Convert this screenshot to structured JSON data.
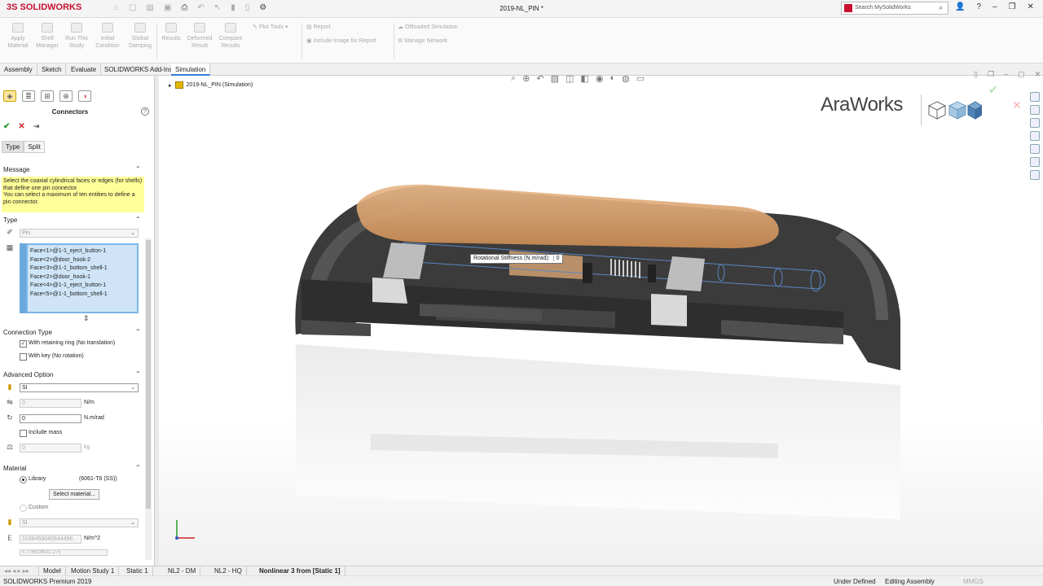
{
  "app": {
    "logo_ds": "3S",
    "logo_name": "SOLIDWORKS",
    "doc_title": "2019-NL_PIN *",
    "search_placeholder": "Search MySolidWorks",
    "version": "SOLIDWORKS Premium 2019"
  },
  "ribbon": {
    "buttons": [
      "Apply Material",
      "Shell Manager",
      "Run This Study",
      "Initial Condition",
      "Global Damping",
      "Results",
      "Deformed Result",
      "Compare Results"
    ],
    "plot_tools": "Plot Tools",
    "report": "Report",
    "include_image": "Include Image for Report",
    "offloaded": "Offloaded Simulation",
    "manage_network": "Manage Network"
  },
  "cmd_tabs": [
    "Assembly",
    "Sketch",
    "Evaluate",
    "SOLIDWORKS Add-Ins",
    "Simulation"
  ],
  "panel": {
    "title": "Connectors",
    "subtabs": [
      "Type",
      "Split"
    ],
    "message_header": "Message",
    "message_text": "Select the coaxial cylindrical faces or edges (for shells) that define one pin connector.\nYou can select a maximum of ten entities to define a pin connector.",
    "type_header": "Type",
    "type_value": "Pin",
    "selections": [
      "Face<1>@1-1_eject_button-1",
      "Face<2>@door_hook-2",
      "Face<3>@1-1_bottom_shell-1",
      "Face<2>@door_hook-1",
      "Face<4>@1-1_eject_button-1",
      "Face<5>@1-1_bottom_shell-1"
    ],
    "connection_header": "Connection Type",
    "retaining_ring": "With retaining ring (No translation)",
    "with_key": "With key (No rotation)",
    "advanced_header": "Advanced Option",
    "units": "SI",
    "axial_value": "0",
    "axial_unit": "N/m",
    "rot_value": "0",
    "rot_unit": "N.m/rad",
    "include_mass": "Include mass",
    "mass_value": "0",
    "mass_unit": "kg",
    "material_header": "Material",
    "library": "Library",
    "library_value": "(6061-T6 (SS))",
    "select_material": "Select material...",
    "custom": "Custom",
    "custom_units": "SI",
    "ex_value": "1038459040944456",
    "ex_unit": "N/m^2",
    "partial_value": "5.7766196AL-275"
  },
  "viewport": {
    "tree_label": "2019-NL_PIN  (Simulation)",
    "watermark": "AraWorks",
    "tooltip_label": "Rotational Stiffness (N.m/rad):",
    "tooltip_value": "0"
  },
  "bottom_tabs": [
    "Model",
    "Motion Study 1",
    "Static 1",
    "NL2 - DM",
    "NL2 - HQ",
    "Nonlinear 3 from [Static 1]"
  ],
  "status": {
    "under_defined": "Under Defined",
    "editing": "Editing Assembly",
    "units": "MMGS"
  },
  "colors": {
    "accent": "#c8102e",
    "copper": "#d9a06b",
    "shell": "#3a3a3a"
  }
}
